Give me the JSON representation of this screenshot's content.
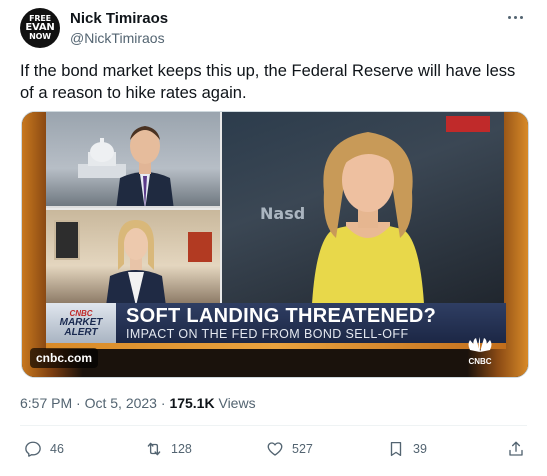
{
  "author": {
    "avatar_line1": "FREE",
    "avatar_line2": "EVAN",
    "avatar_line3": "NOW",
    "name": "Nick Timiraos",
    "handle": "@NickTimiraos"
  },
  "tweet": {
    "text": "If the bond market keeps this up, the Federal Reserve will have less of a reason to hike rates again."
  },
  "media": {
    "background_text": "Nasd",
    "alert_cnbc": "CNBC",
    "alert_line1": "MARKET",
    "alert_line2": "ALERT",
    "headline": "SOFT LANDING THREATENED?",
    "subheadline": "IMPACT ON THE FED FROM BOND SELL-OFF",
    "logo_text": "CNBC",
    "source": "cnbc.com"
  },
  "meta": {
    "time": "6:57 PM",
    "dot1": "·",
    "date": "Oct 5, 2023",
    "dot2": "·",
    "views_count": "175.1K",
    "views_label": "Views"
  },
  "actions": {
    "replies": "46",
    "retweets": "128",
    "likes": "527",
    "bookmarks": "39"
  },
  "icons": [
    "more-icon",
    "reply-icon",
    "retweet-icon",
    "like-icon",
    "bookmark-icon",
    "share-icon",
    "cnbc-peacock-icon"
  ],
  "colors": {
    "text_primary": "#0f1419",
    "text_secondary": "#536471",
    "lower_third": "#1c2745",
    "accent_orange": "#d88a28"
  }
}
